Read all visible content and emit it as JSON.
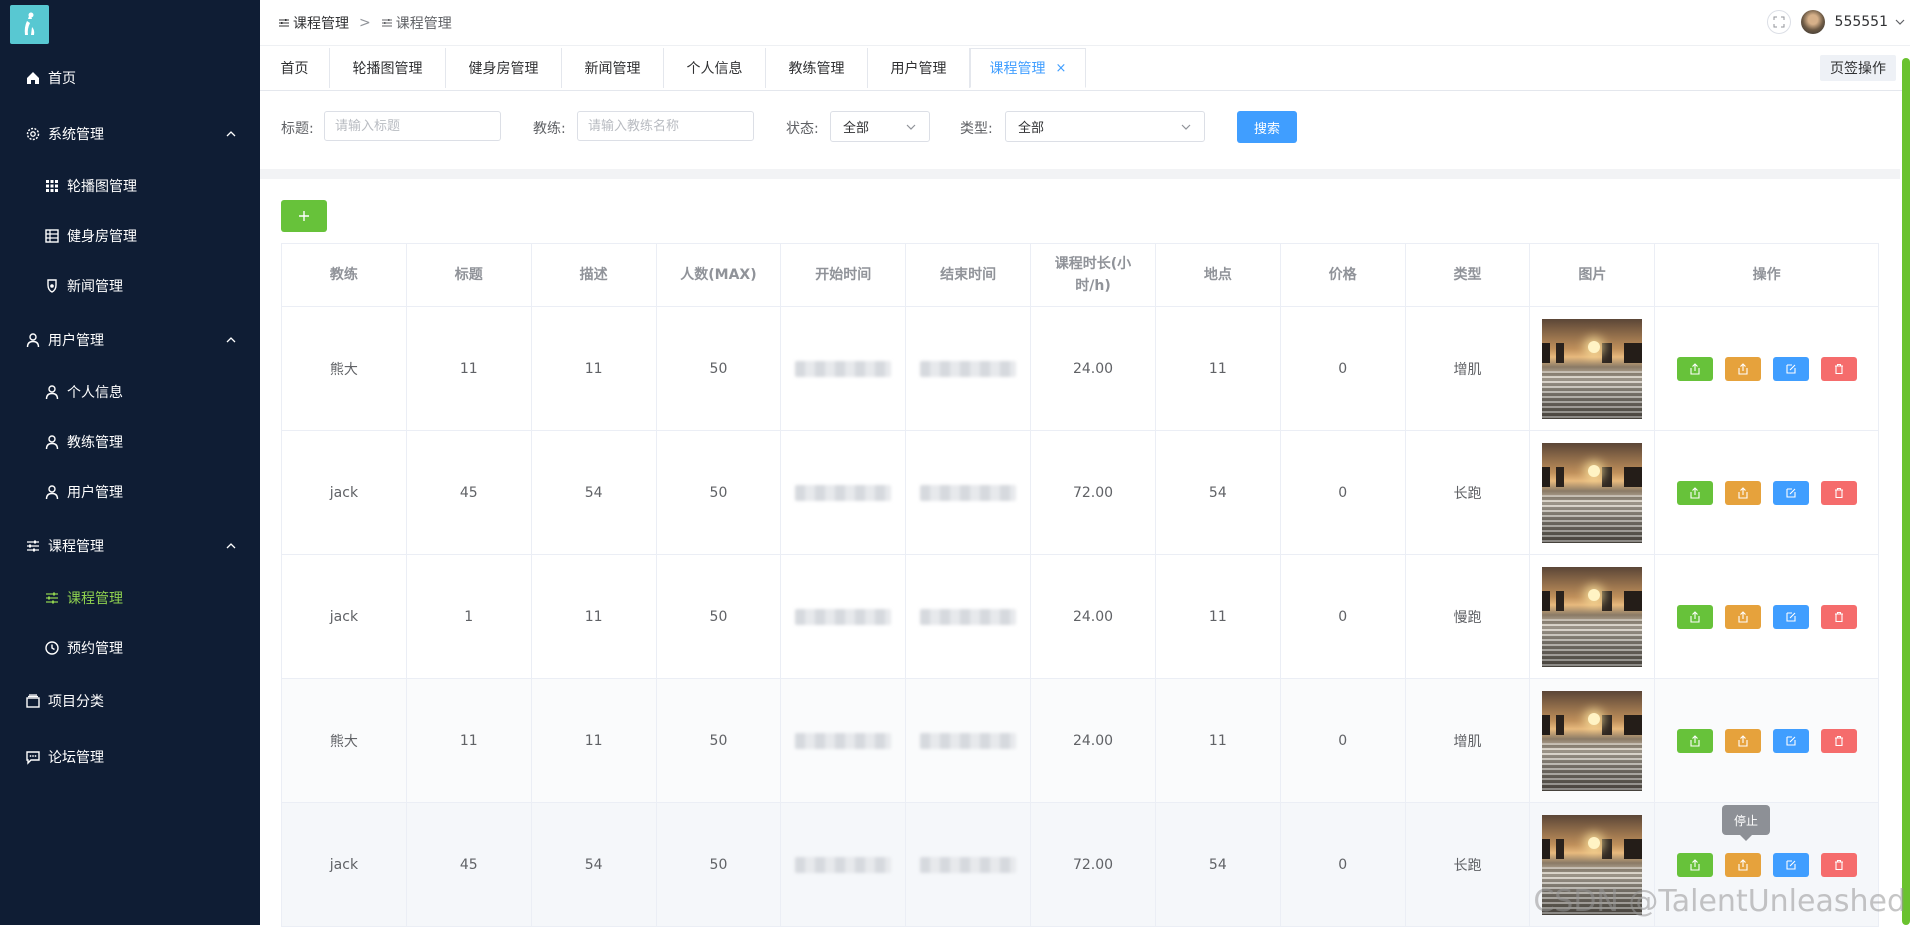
{
  "sidebar": {
    "items": [
      {
        "label": "首页",
        "icon": "home-icon"
      },
      {
        "label": "系统管理",
        "icon": "gear-icon"
      },
      {
        "label": "轮播图管理",
        "icon": "grid-icon"
      },
      {
        "label": "健身房管理",
        "icon": "building-icon"
      },
      {
        "label": "新闻管理",
        "icon": "badge-icon"
      },
      {
        "label": "用户管理",
        "icon": "user-icon"
      },
      {
        "label": "个人信息",
        "icon": "user-icon"
      },
      {
        "label": "教练管理",
        "icon": "user-icon"
      },
      {
        "label": "用户管理",
        "icon": "user-icon"
      },
      {
        "label": "课程管理",
        "icon": "sliders-icon"
      },
      {
        "label": "课程管理",
        "icon": "sliders-icon"
      },
      {
        "label": "预约管理",
        "icon": "clock-icon"
      },
      {
        "label": "项目分类",
        "icon": "box-icon"
      },
      {
        "label": "论坛管理",
        "icon": "chat-icon"
      }
    ],
    "active_color": "#8fd14f"
  },
  "breadcrumb": [
    "课程管理",
    "课程管理"
  ],
  "header": {
    "username": "555551"
  },
  "tabs": [
    "首页",
    "轮播图管理",
    "健身房管理",
    "新闻管理",
    "个人信息",
    "教练管理",
    "用户管理",
    "课程管理"
  ],
  "tabs_close": "×",
  "tab_ops_label": "页签操作",
  "search": {
    "title_label": "标题:",
    "title_placeholder": "请输入标题",
    "coach_label": "教练:",
    "coach_placeholder": "请输入教练名称",
    "status_label": "状态:",
    "status_value": "全部",
    "type_label": "类型:",
    "type_value": "全部",
    "search_button": "搜索"
  },
  "table": {
    "headers": [
      "教练",
      "标题",
      "描述",
      "人数(MAX)",
      "开始时间",
      "结束时间",
      "课程时长(小时/h)",
      "地点",
      "价格",
      "类型",
      "图片",
      "操作"
    ],
    "rows": [
      {
        "coach": "熊大",
        "title": "11",
        "desc": "11",
        "max": "50",
        "duration": "24.00",
        "place": "11",
        "price": "0",
        "type": "增肌"
      },
      {
        "coach": "jack",
        "title": "45",
        "desc": "54",
        "max": "50",
        "duration": "72.00",
        "place": "54",
        "price": "0",
        "type": "长跑"
      },
      {
        "coach": "jack",
        "title": "1",
        "desc": "11",
        "max": "50",
        "duration": "24.00",
        "place": "11",
        "price": "0",
        "type": "慢跑"
      },
      {
        "coach": "熊大",
        "title": "11",
        "desc": "11",
        "max": "50",
        "duration": "24.00",
        "place": "11",
        "price": "0",
        "type": "增肌"
      },
      {
        "coach": "jack",
        "title": "45",
        "desc": "54",
        "max": "50",
        "duration": "72.00",
        "place": "54",
        "price": "0",
        "type": "长跑"
      }
    ]
  },
  "tooltip": "停止",
  "watermark": "CSDN @TalentUnleashed",
  "colors": {
    "primary": "#409eff",
    "success": "#67c23a",
    "warning": "#e6a23c",
    "danger": "#f56c6c",
    "sidebar": "#0f1d34"
  }
}
